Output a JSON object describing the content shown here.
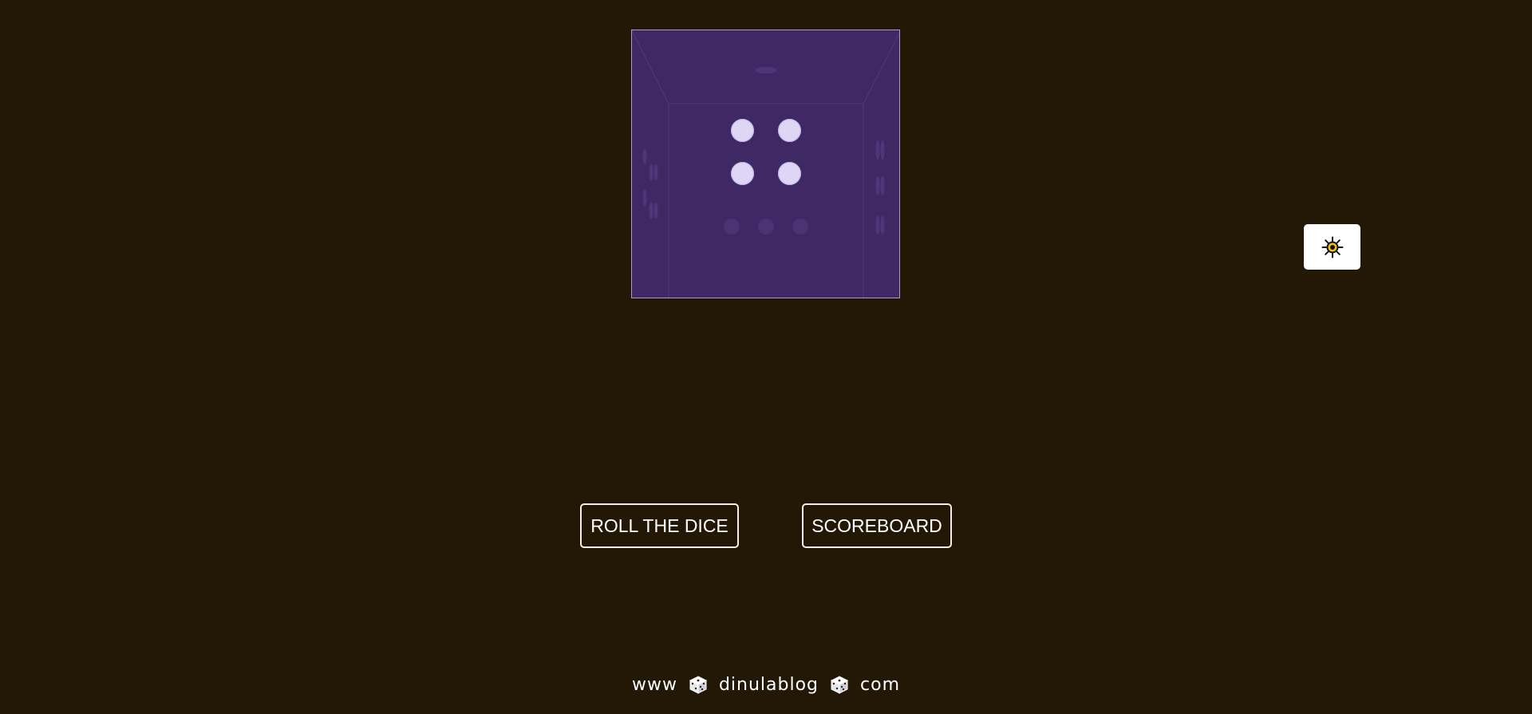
{
  "dice": {
    "face_value": 4,
    "face_color": "#3e2965",
    "pip_color": "#ddd6f4"
  },
  "theme_toggle": {
    "icon": "sun-icon"
  },
  "buttons": {
    "roll_label": "ROLL THE DICE",
    "scoreboard_label": "SCOREBOARD"
  },
  "footer": {
    "part1": "www",
    "part2": "dinulablog",
    "part3": "com",
    "separator_icon": "die-icon"
  },
  "colors": {
    "background": "#221805",
    "button_border": "#f3f0ea",
    "text": "#ffffff"
  }
}
